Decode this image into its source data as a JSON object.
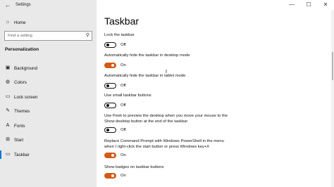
{
  "window": {
    "title": "Settings",
    "back_glyph": "←",
    "controls": {
      "minimize": "—",
      "maximize": "☐",
      "close": "✕"
    }
  },
  "sidebar": {
    "home_label": "Home",
    "search_placeholder": "Find a setting",
    "section_title": "Personalization",
    "items": [
      {
        "label": "Background",
        "icon": "image-icon"
      },
      {
        "label": "Colors",
        "icon": "palette-icon"
      },
      {
        "label": "Lock screen",
        "icon": "lock-screen-icon"
      },
      {
        "label": "Themes",
        "icon": "brush-icon"
      },
      {
        "label": "Fonts",
        "icon": "font-icon"
      },
      {
        "label": "Start",
        "icon": "start-icon"
      },
      {
        "label": "Taskbar",
        "icon": "taskbar-icon",
        "active": true
      }
    ]
  },
  "main": {
    "title": "Taskbar",
    "settings": [
      {
        "label": "Lock the taskbar",
        "state": "Off"
      },
      {
        "label": "Automatically hide the taskbar in desktop mode",
        "state": "On"
      },
      {
        "label": "Automatically hide the taskbar in tablet mode",
        "state": "Off"
      },
      {
        "label": "Use small taskbar buttons",
        "state": "Off"
      },
      {
        "label": "Use Peek to preview the desktop when you move your mouse to the\nShow desktop button at the end of the taskbar",
        "state": "Off"
      },
      {
        "label": "Replace Command Prompt with Windows PowerShell in the menu\nwhen I right-click the start button or press Windows key+X",
        "state": "On"
      },
      {
        "label": "Show badges on taskbar buttons",
        "state": "On"
      }
    ]
  },
  "colors": {
    "accent": "#d05c16",
    "selection": "#0078d7",
    "sidebar_bg": "#e9e9e9"
  }
}
